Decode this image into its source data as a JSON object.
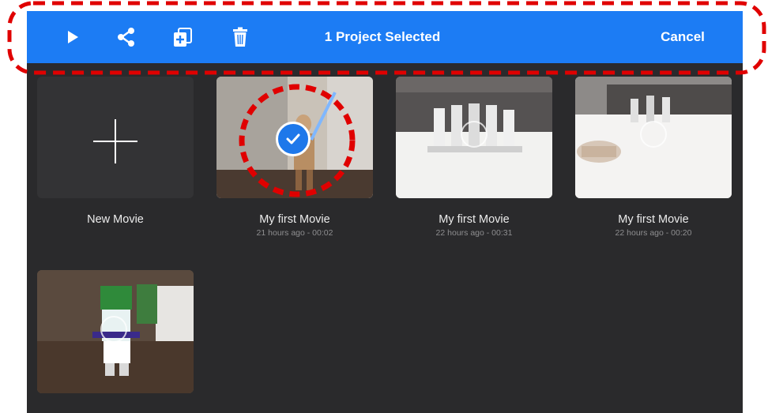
{
  "toolbar": {
    "title": "1 Project Selected",
    "cancel_label": "Cancel",
    "icons": [
      "play-icon",
      "share-icon",
      "duplicate-icon",
      "trash-icon"
    ],
    "background_color": "#1c7cf4"
  },
  "projects": [
    {
      "kind": "new",
      "title": "New Movie",
      "subtitle": ""
    },
    {
      "kind": "movie",
      "title": "My first Movie",
      "subtitle": "21 hours ago - 00:02",
      "selected": true
    },
    {
      "kind": "movie",
      "title": "My first Movie",
      "subtitle": "22 hours ago - 00:31",
      "selected": false
    },
    {
      "kind": "movie",
      "title": "My first Movie",
      "subtitle": "22 hours ago - 00:20",
      "selected": false
    },
    {
      "kind": "movie",
      "title": "",
      "subtitle": "",
      "selected": false
    }
  ],
  "annotation_color": "#e00000"
}
